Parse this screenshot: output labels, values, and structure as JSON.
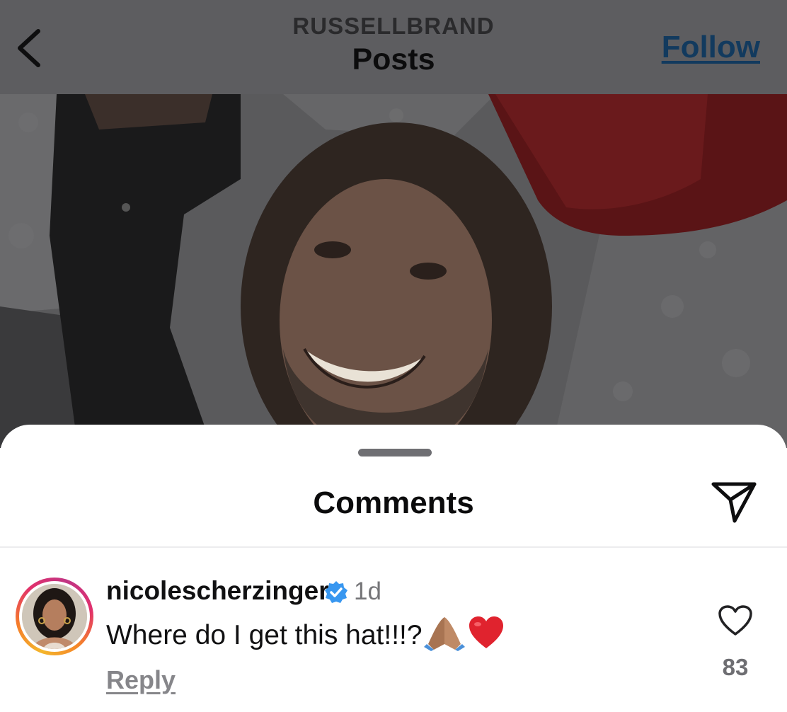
{
  "header": {
    "account": "RUSSELLBRAND",
    "title": "Posts",
    "follow_label": "Follow",
    "back_icon": "chevron-left-icon"
  },
  "post": {
    "image_description_icon": "post-photo"
  },
  "comments_sheet": {
    "title": "Comments",
    "share_icon": "paper-plane-icon",
    "comments": [
      {
        "username": "nicolescherzinger",
        "verified": true,
        "time": "1d",
        "text": "Where do I get this hat!!!?",
        "emojis": [
          "🙏🏽",
          "❤️"
        ],
        "reply_label": "Reply",
        "like_icon": "heart-outline-icon",
        "like_count": "83"
      }
    ]
  },
  "colors": {
    "follow_link": "#123a5e",
    "verified_badge": "#3897f0",
    "story_ring_start": "#f4b62b",
    "story_ring_end": "#c13584",
    "overlay": "#5d5d60"
  }
}
